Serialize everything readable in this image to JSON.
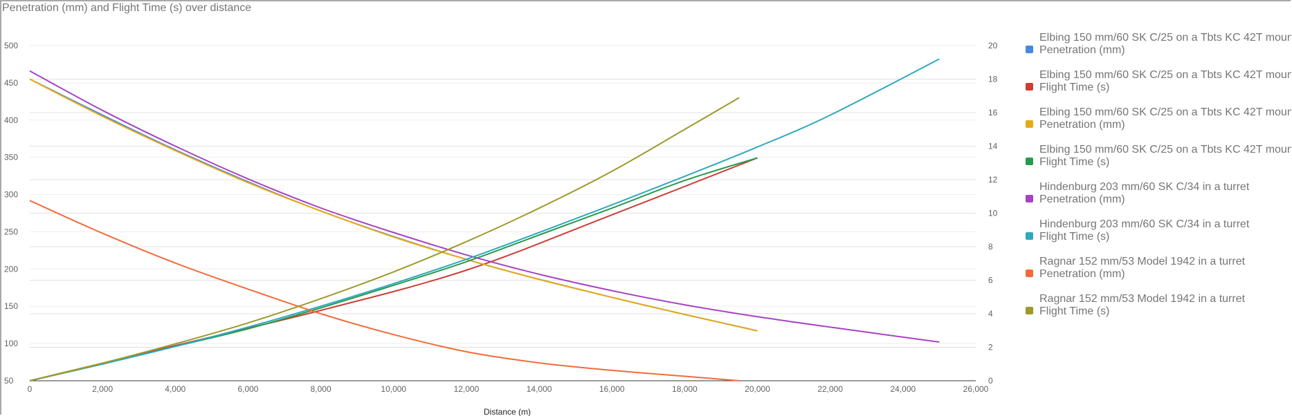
{
  "chart_data": {
    "type": "line",
    "title": "Penetration (mm) and Flight Time (s) over distance",
    "xlabel": "Distance (m)",
    "xlim": [
      0,
      26000
    ],
    "xticks": [
      "0",
      "2,000",
      "4,000",
      "6,000",
      "8,000",
      "10,000",
      "12,000",
      "14,000",
      "16,000",
      "18,000",
      "20,000",
      "22,000",
      "24,000",
      "26,000"
    ],
    "y_left": {
      "ylim": [
        50,
        500
      ],
      "ticks": [
        "50",
        "100",
        "150",
        "200",
        "250",
        "300",
        "350",
        "400",
        "450",
        "500"
      ]
    },
    "y_right": {
      "ylim": [
        0,
        20
      ],
      "ticks": [
        "0",
        "2",
        "4",
        "6",
        "8",
        "10",
        "12",
        "14",
        "16",
        "18",
        "20"
      ]
    },
    "grid": true,
    "legend_position": "right",
    "series": [
      {
        "name": "Elbing 150 mm/60 SK C/25 on a Tbts KC 42T moun",
        "sub": "Penetration (mm)",
        "color": "#4a86e8",
        "axis": "left",
        "x": [
          0,
          4000,
          8000,
          12000,
          16000,
          20000
        ],
        "y": [
          455,
          360,
          278,
          213,
          162,
          117
        ]
      },
      {
        "name": "Elbing 150 mm/60 SK C/25 on a Tbts KC 42T moun",
        "sub": "Flight Time (s)",
        "color": "#cc3d34",
        "axis": "right",
        "x": [
          0,
          4000,
          8000,
          12000,
          16000,
          20000
        ],
        "y": [
          0,
          2.1,
          4.2,
          6.6,
          9.9,
          13.3
        ]
      },
      {
        "name": "Elbing 150 mm/60 SK C/25 on a Tbts KC 42T moun",
        "sub": "Penetration (mm)",
        "color": "#e6ab14",
        "axis": "left",
        "x": [
          0,
          2000,
          4000,
          6000,
          8000,
          10000,
          12000,
          14000,
          16000,
          18000,
          20000
        ],
        "y": [
          455,
          405,
          359,
          316,
          278,
          243,
          213,
          186,
          162,
          139,
          117
        ]
      },
      {
        "name": "Elbing 150 mm/60 SK C/25 on a Tbts KC 42T moun",
        "sub": "Flight Time (s)",
        "color": "#289a4e",
        "axis": "right",
        "x": [
          0,
          2000,
          4000,
          6000,
          8000,
          10000,
          12000,
          14000,
          16000,
          18000,
          20000
        ],
        "y": [
          0,
          1.0,
          2.05,
          3.1,
          4.35,
          5.7,
          7.1,
          8.7,
          10.3,
          11.95,
          13.3
        ]
      },
      {
        "name": "Hindenburg 203 mm/60 SK C/34 in a turret",
        "sub": "Penetration (mm)",
        "color": "#a543c4",
        "axis": "left",
        "x": [
          0,
          2000,
          4000,
          6000,
          8000,
          10000,
          12000,
          14000,
          16000,
          18000,
          20000,
          22000,
          25000
        ],
        "y": [
          466,
          413,
          365,
          321,
          282,
          249,
          219,
          193,
          171,
          152,
          136,
          122,
          102
        ]
      },
      {
        "name": "Hindenburg 203 mm/60 SK C/34 in a turret",
        "sub": "Flight Time (s)",
        "color": "#2ea8bd",
        "axis": "right",
        "x": [
          0,
          2000,
          4000,
          6000,
          8000,
          10000,
          12000,
          14000,
          16000,
          18000,
          20000,
          22000,
          25000
        ],
        "y": [
          0,
          1.0,
          2.05,
          3.2,
          4.45,
          5.8,
          7.25,
          8.85,
          10.5,
          12.2,
          13.95,
          15.85,
          19.2
        ]
      },
      {
        "name": "Ragnar 152 mm/53 Model 1942 in a turret",
        "sub": "Penetration (mm)",
        "color": "#f26b3a",
        "axis": "left",
        "x": [
          0,
          2000,
          4000,
          6000,
          8000,
          10000,
          12000,
          14000,
          16000,
          18000,
          19500
        ],
        "y": [
          292,
          248,
          208,
          173,
          140,
          112,
          89,
          74,
          64,
          56,
          50
        ]
      },
      {
        "name": "Ragnar 152 mm/53 Model 1942 in a turret",
        "sub": "Flight Time (s)",
        "color": "#9c9a2a",
        "axis": "right",
        "x": [
          0,
          2000,
          4000,
          6000,
          8000,
          10000,
          12000,
          14000,
          16000,
          18000,
          19500
        ],
        "y": [
          0,
          1.05,
          2.2,
          3.45,
          4.9,
          6.5,
          8.3,
          10.3,
          12.5,
          15.0,
          16.9
        ]
      }
    ]
  }
}
